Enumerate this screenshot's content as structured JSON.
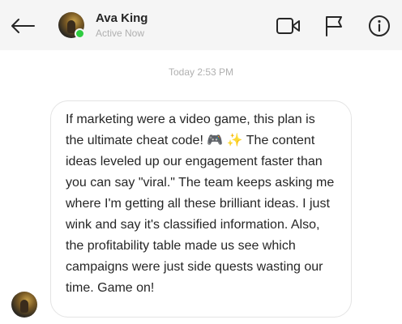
{
  "header": {
    "name": "Ava King",
    "status": "Active Now",
    "icons": [
      "back-arrow-icon",
      "video-camera-icon",
      "flag-icon",
      "info-icon"
    ]
  },
  "conversation": {
    "timestamp": "Today 2:53 PM",
    "message": "If marketing were a video game, this plan is the ultimate cheat code! 🎮 ✨ The content ideas leveled up our engagement faster than you can say \"viral.\" The team keeps asking me where I'm getting all these brilliant ideas. I just wink and say it's classified information. Also, the profitability table made us see which campaigns were just side quests wasting our time. Game on!"
  },
  "colors": {
    "header_bg": "#f5f5f5",
    "online": "#2ecc40",
    "muted_text": "#b0b0b0",
    "bubble_border": "#e4e4e4"
  }
}
